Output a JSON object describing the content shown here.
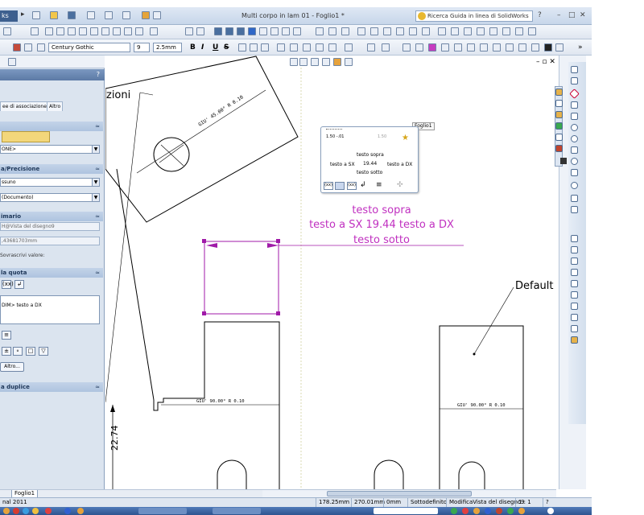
{
  "titlebar": {
    "app_label": "ks",
    "document_title": "Multi corpo in lam 01 - Foglio1 *",
    "help_search_placeholder": "Ricerca Guida in linea di SolidWorks"
  },
  "format_toolbar": {
    "font": "Century Gothic",
    "size": "9",
    "dimension": "2.5mm",
    "bold": "B",
    "italic": "I",
    "underline": "U",
    "strike": "S"
  },
  "panel": {
    "tabs": [
      "ee di associazione",
      "Altro"
    ],
    "group_precisione": "a/Precisione",
    "group_primario": "imario",
    "group_quota": "la quota",
    "group_duplice": "a duplice",
    "select_none": "ONE>",
    "select_nessuno": "ssuno",
    "select_documento": "(Documento)",
    "field_vista": "H@Vista del disegno9",
    "field_value": ",43681703mm",
    "label_sovrascrivi": "Sovrascrivi valore:",
    "text_area": "DIM> testo a DX",
    "altro_button": "Altro...",
    "quota_buttons": [
      "(xx)",
      "↲"
    ],
    "symbol_buttons": [
      "±",
      "∘",
      "□",
      "▽"
    ]
  },
  "drawing": {
    "label_zioni": "zioni",
    "label_default": "Default",
    "dim_top": "testo sopra",
    "dim_middle": "testo a SX 19.44 testo a DX",
    "dim_bottom": "testo sotto",
    "vertical_dim": "22.74",
    "note_angle_top": "GIU' 45.00°  R 0.10",
    "note_left": "GIU' 90.00°  R 0.10",
    "note_right": "GIU' 90.00°  R 0.10"
  },
  "popup": {
    "tag": "Foglio1",
    "top_text": "testo sopra",
    "left_text": "testo a SX",
    "value": "19.44",
    "right_text": "testo a DX",
    "bottom_text": "testo sotto",
    "icon_precision": "1.50\n-.01",
    "icon_tolerance": "1.50"
  },
  "sheet_tab": "Foglio1",
  "status": {
    "left": "nal 2011",
    "x": "178.25mm",
    "y": "270.01mm",
    "z": "0mm",
    "state": "Sottodefinito",
    "mode": "ModificaVista del disegno9",
    "scale": "1 : 1"
  }
}
